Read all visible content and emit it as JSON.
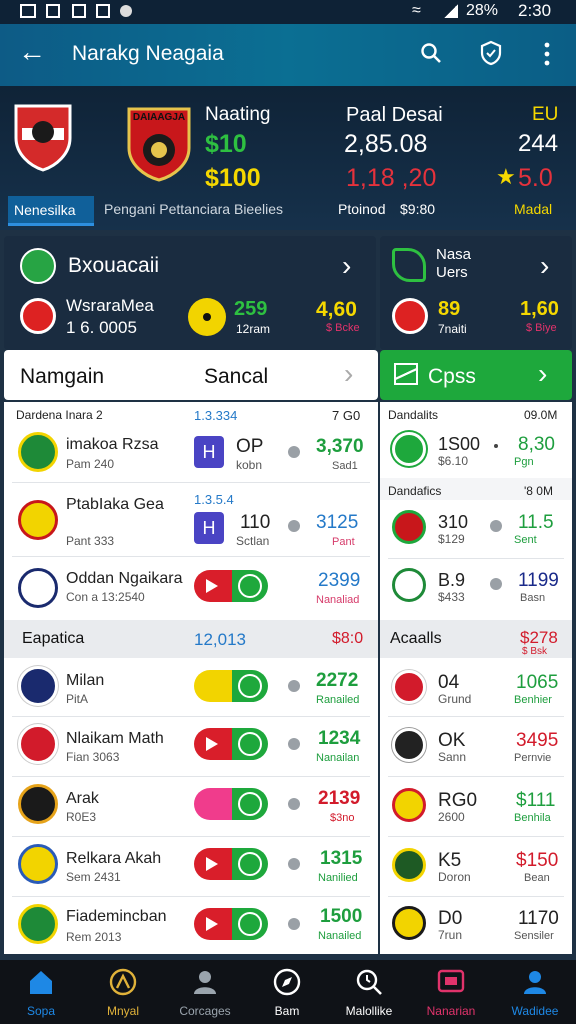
{
  "status": {
    "battery": "28%",
    "time": "2:30"
  },
  "appbar": {
    "title": "Narakg Neagaia"
  },
  "hero": {
    "crest_text": "DAIAAGJA",
    "col1_title": "Naating",
    "col1_v1": "$10",
    "col1_v2": "$100",
    "col2_title": "Paal Desai",
    "col2_v1": "2,85.08",
    "col2_v2": "1,18 ,20",
    "col3_title": "EU",
    "col3_v1": "244",
    "col3_v2": "5.0",
    "tab_active": "Nenesilka",
    "tab_text": "Pengani Pettanciara Bieelies",
    "protected": "Ptoinod",
    "protected_val": "$9:80",
    "madal": "Madal"
  },
  "card_left": {
    "title": "Bxouacaii",
    "team": "WsraraMea",
    "team_sub": "1 6. 0005",
    "num1": "259",
    "num1_sub": "12ram",
    "num2": "4,60",
    "num2_sub": "$ Bcke"
  },
  "card_right": {
    "title1": "Nasa",
    "title2": "Uers",
    "num1": "89",
    "num1_sub": "7naiti",
    "num2": "1,60",
    "num2_sub": "$ Biye"
  },
  "tabs": {
    "left_a": "Namgain",
    "left_b": "Sancal",
    "right": "Cpss"
  },
  "left_list": {
    "header_a": "Dardena Inara 2",
    "header_b": "1.3.334",
    "header_c": "7 G0",
    "rows": [
      {
        "name": "imakoa Rzsa",
        "sub": "Pam 240",
        "code": "OP",
        "code_sub": "kobn",
        "val": "3,370",
        "val_sub": "Sad1",
        "badge": "H",
        "val_color": "#1e9e3e",
        "sub_color": "#555"
      },
      {
        "name": "PtabIaka Gea",
        "sub": "Pant 333",
        "code": "110",
        "code_sub": "Sctlan",
        "val": "3125",
        "val_sub": "Pant",
        "badge": "H",
        "val_color": "#2479c8",
        "sub_color": "#d63b6a",
        "top_note": "1.3.5.4"
      },
      {
        "name": "Oddan Ngaikara",
        "sub": "Con a 13:2540",
        "code": "",
        "code_sub": "",
        "val": "2399",
        "val_sub": "Nanaliad",
        "val_color": "#2479c8",
        "sub_color": "#d63b6a"
      }
    ]
  },
  "right_list": {
    "header_a": "Dandalits",
    "header_b": "09.0M",
    "header2_a": "Dandafics",
    "header2_b": "'8 0M",
    "rows": [
      {
        "code": "1S00",
        "code_sub": "$6.10",
        "val": "8,30",
        "val_sub": "Pgn",
        "val_color": "#1e9e3e",
        "sub_color": "#1e9e3e"
      },
      {
        "code": "310",
        "code_sub": "$129",
        "val": "11.5",
        "val_sub": "Sent",
        "val_color": "#1e9e3e",
        "sub_color": "#1e9e3e"
      },
      {
        "code": "B.9",
        "code_sub": "$433",
        "val": "1199",
        "val_sub": "Basn",
        "val_color": "#1a2a8a",
        "sub_color": "#555"
      }
    ]
  },
  "section2": {
    "left_title": "Eapatica",
    "left_mid": "12,013",
    "left_right": "$8:0",
    "right_title": "Acaalls",
    "right_val": "$278",
    "right_sub": "$ Bsk",
    "left_rows": [
      {
        "name": "Milan",
        "sub": "PitA",
        "val": "2272",
        "val_sub": "Ranailed",
        "val_color": "#1e9e3e",
        "sub_color": "#1e9e3e"
      },
      {
        "name": "Nlaikam Math",
        "sub": "Fian 3063",
        "val": "1234",
        "val_sub": "Nanailan",
        "val_color": "#1e9e3e",
        "sub_color": "#1e9e3e"
      },
      {
        "name": "Arak",
        "sub": "R0E3",
        "val": "2139",
        "val_sub": "$3no",
        "val_color": "#d21b2b",
        "sub_color": "#d21b2b"
      },
      {
        "name": "Relkara Akah",
        "sub": "Sem 2431",
        "val": "1315",
        "val_sub": "Nanilied",
        "val_color": "#1e9e3e",
        "sub_color": "#1e9e3e"
      },
      {
        "name": "Fiademincban",
        "sub": "Rem 2013",
        "val": "1500",
        "val_sub": "Nanailed",
        "val_color": "#1e9e3e",
        "sub_color": "#1e9e3e"
      }
    ],
    "right_rows": [
      {
        "code": "04",
        "code_sub": "Grund",
        "val": "1065",
        "val_sub": "Benhier",
        "val_color": "#1e9e3e",
        "sub_color": "#1e9e3e"
      },
      {
        "code": "OK",
        "code_sub": "Sann",
        "val": "3495",
        "val_sub": "Pernvie",
        "val_color": "#d21b2b",
        "sub_color": "#555"
      },
      {
        "code": "RG0",
        "code_sub": "2600",
        "val": "$111",
        "val_sub": "Benhila",
        "val_color": "#1e9e3e",
        "sub_color": "#1e9e3e"
      },
      {
        "code": "K5",
        "code_sub": "Doron",
        "val": "$150",
        "val_sub": "Bean",
        "val_color": "#d21b2b",
        "sub_color": "#555"
      },
      {
        "code": "D0",
        "code_sub": "7run",
        "val": "1170",
        "val_sub": "Sensiler",
        "val_color": "#222",
        "sub_color": "#555"
      }
    ]
  },
  "nav": [
    {
      "label": "Sopa",
      "color": "#1e88e5"
    },
    {
      "label": "Mnyal",
      "color": "#e0b23a"
    },
    {
      "label": "Corcages",
      "color": "#9aa4ad"
    },
    {
      "label": "Bam",
      "color": "#ffffff"
    },
    {
      "label": "Malollike",
      "color": "#ffffff"
    },
    {
      "label": "Nanarian",
      "color": "#e0336b"
    },
    {
      "label": "Wadidee",
      "color": "#1e88e5"
    }
  ],
  "colors": {
    "accent": "#0b6f93",
    "green": "#1ea83c",
    "red": "#d21b2b",
    "yellow": "#f2d400"
  }
}
